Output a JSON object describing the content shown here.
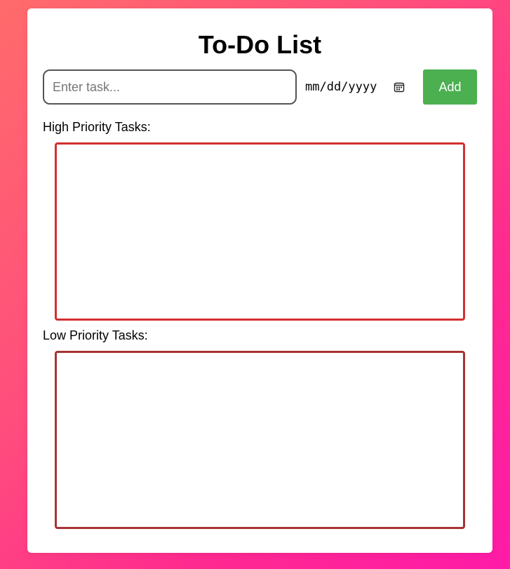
{
  "app": {
    "title": "To-Do List"
  },
  "form": {
    "task_placeholder": "Enter task...",
    "task_value": "",
    "date_placeholder": "mm/dd/yyyy",
    "add_label": "Add"
  },
  "sections": {
    "high": {
      "label": "High Priority Tasks:",
      "items": []
    },
    "low": {
      "label": "Low Priority Tasks:",
      "items": []
    }
  },
  "colors": {
    "add_button": "#4caf50",
    "high_border": "#d32f2f",
    "low_border": "#a83232"
  },
  "icons": {
    "date": "calendar-icon"
  }
}
